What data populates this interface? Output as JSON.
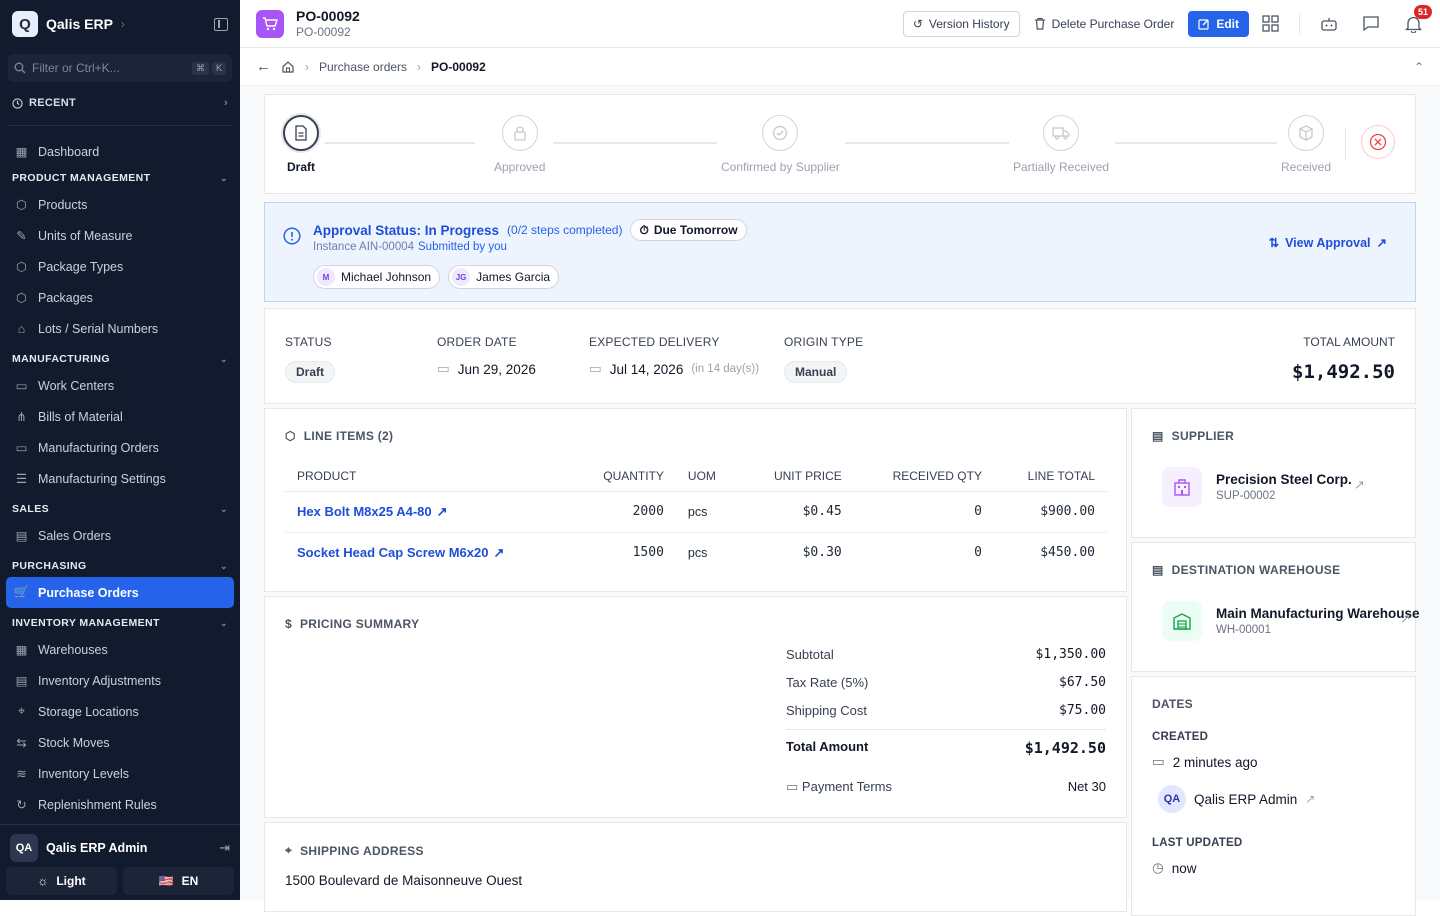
{
  "app": {
    "name": "Qalis ERP",
    "logo_letter": "Q"
  },
  "sidebar": {
    "filter_placeholder": "Filter or Ctrl+K...",
    "kbd": [
      "⌘",
      "K"
    ],
    "recent_label": "RECENT",
    "dashboard": "Dashboard",
    "sections": [
      {
        "title": "PRODUCT MANAGEMENT",
        "items": [
          "Products",
          "Units of Measure",
          "Package Types",
          "Packages",
          "Lots / Serial Numbers"
        ]
      },
      {
        "title": "MANUFACTURING",
        "items": [
          "Work Centers",
          "Bills of Material",
          "Manufacturing Orders",
          "Manufacturing Settings"
        ]
      },
      {
        "title": "SALES",
        "items": [
          "Sales Orders"
        ]
      },
      {
        "title": "PURCHASING",
        "items": [
          "Purchase Orders"
        ]
      },
      {
        "title": "INVENTORY MANAGEMENT",
        "items": [
          "Warehouses",
          "Inventory Adjustments",
          "Storage Locations",
          "Stock Moves",
          "Inventory Levels",
          "Replenishment Rules"
        ]
      }
    ],
    "active_item": "Purchase Orders",
    "user": {
      "initials": "QA",
      "name": "Qalis ERP Admin"
    },
    "theme_label": "Light",
    "lang_label": "EN",
    "lang_flag": "🇺🇸"
  },
  "header": {
    "title": "PO-00092",
    "subtitle": "PO-00092",
    "version_history": "Version History",
    "delete": "Delete Purchase Order",
    "edit": "Edit",
    "notifications": "51"
  },
  "breadcrumb": {
    "parent": "Purchase orders",
    "current": "PO-00092"
  },
  "workflow": {
    "steps": [
      "Draft",
      "Approved",
      "Confirmed by Supplier",
      "Partially Received",
      "Received"
    ],
    "current_index": 0
  },
  "approval": {
    "status": "Approval Status: In Progress",
    "progress": "(0/2 steps completed)",
    "due": "Due Tomorrow",
    "instance": "Instance AIN-00004",
    "submitted": "Submitted by you",
    "approvers": [
      {
        "initials": "M",
        "name": "Michael Johnson"
      },
      {
        "initials": "JG",
        "name": "James Garcia"
      }
    ],
    "view_label": "View Approval"
  },
  "summary": {
    "status_label": "STATUS",
    "status": "Draft",
    "order_date_label": "ORDER DATE",
    "order_date": "Jun 29, 2026",
    "expected_label": "EXPECTED DELIVERY",
    "expected": "Jul 14, 2026",
    "expected_note": "(in 14 day(s))",
    "origin_label": "ORIGIN TYPE",
    "origin": "Manual",
    "total_label": "TOTAL AMOUNT",
    "total": "$1,492.50"
  },
  "line_items": {
    "title": "LINE ITEMS (2)",
    "columns": [
      "PRODUCT",
      "QUANTITY",
      "UOM",
      "UNIT PRICE",
      "RECEIVED QTY",
      "LINE TOTAL"
    ],
    "rows": [
      {
        "product": "Hex Bolt M8x25 A4-80",
        "quantity": "2000",
        "uom": "pcs",
        "unit_price": "$0.45",
        "received": "0",
        "line_total": "$900.00"
      },
      {
        "product": "Socket Head Cap Screw M6x20",
        "quantity": "1500",
        "uom": "pcs",
        "unit_price": "$0.30",
        "received": "0",
        "line_total": "$450.00"
      }
    ]
  },
  "pricing": {
    "title": "PRICING SUMMARY",
    "subtotal_label": "Subtotal",
    "subtotal": "$1,350.00",
    "tax_label": "Tax Rate (5%)",
    "tax": "$67.50",
    "shipping_label": "Shipping Cost",
    "shipping": "$75.00",
    "total_label": "Total Amount",
    "total": "$1,492.50",
    "terms_label": "Payment Terms",
    "terms": "Net 30"
  },
  "shipping": {
    "title": "SHIPPING ADDRESS",
    "address": "1500 Boulevard de Maisonneuve Ouest"
  },
  "supplier": {
    "title": "SUPPLIER",
    "name": "Precision Steel Corp.",
    "code": "SUP-00002"
  },
  "warehouse": {
    "title": "DESTINATION WAREHOUSE",
    "name": "Main Manufacturing Warehouse",
    "code": "WH-00001"
  },
  "dates": {
    "title": "DATES",
    "created_label": "CREATED",
    "created": "2 minutes ago",
    "creator_initials": "QA",
    "creator": "Qalis ERP Admin",
    "updated_label": "LAST UPDATED",
    "updated": "now"
  },
  "colors": {
    "primary": "#2563eb",
    "sidebar_bg": "#121a2e",
    "po_icon": "#a855f7",
    "badge": "#dc2626"
  }
}
